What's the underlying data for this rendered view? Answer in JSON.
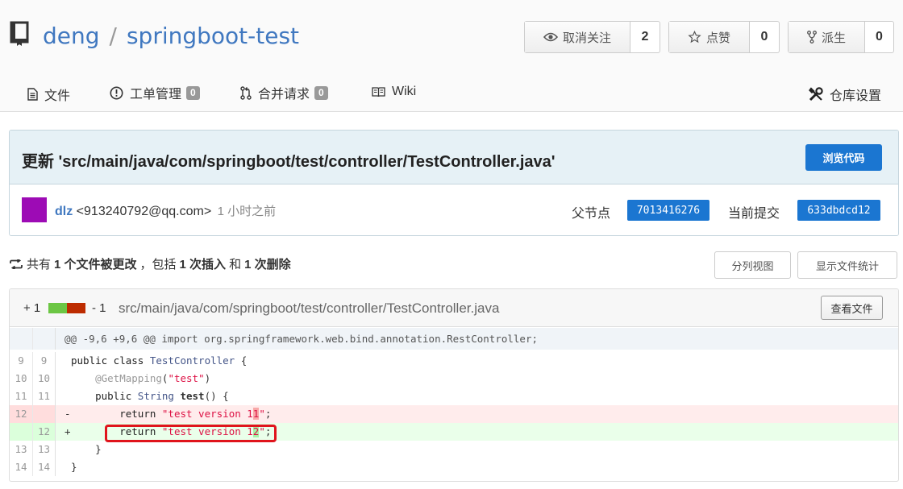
{
  "repo": {
    "owner": "deng",
    "separator": "/",
    "name": "springboot-test"
  },
  "actions": {
    "watch": {
      "label": "取消关注",
      "count": "2",
      "icon": "eye-icon"
    },
    "star": {
      "label": "点赞",
      "count": "0",
      "icon": "star-icon"
    },
    "fork": {
      "label": "派生",
      "count": "0",
      "icon": "fork-icon"
    }
  },
  "nav": {
    "files": "文件",
    "issues": "工单管理",
    "issues_count": "0",
    "pulls": "合并请求",
    "pulls_count": "0",
    "wiki": "Wiki",
    "settings": "仓库设置"
  },
  "commit": {
    "title": "更新 'src/main/java/com/springboot/test/controller/TestController.java'",
    "browse_label": "浏览代码",
    "author_name": "dlz",
    "author_email": "<913240792@qq.com>",
    "time": "1 小时之前",
    "parent_label": "父节点",
    "parent_sha": "7013416276",
    "current_label": "当前提交",
    "current_sha": "633dbdcd12",
    "avatar_color": "#9d0bb5"
  },
  "summary": {
    "p1": "共有",
    "files": "1 个文件被更改",
    "p2": "，包括",
    "insertions": "1 次插入",
    "p3": "和",
    "deletions": "1 次删除",
    "split_label": "分列视图",
    "stats_label": "显示文件统计"
  },
  "file": {
    "additions": "+ 1",
    "deletions": "- 1",
    "path": "src/main/java/com/springboot/test/controller/TestController.java",
    "view_label": "查看文件"
  },
  "diff": {
    "hunk": "@@ -9,6 +9,6 @@ import org.springframework.web.bind.annotation.RestController;",
    "lines": [
      {
        "old": "9",
        "new": "9",
        "sign": "",
        "code": "public class TestController {"
      },
      {
        "old": "10",
        "new": "10",
        "sign": "",
        "code": "    @GetMapping(\"test\")"
      },
      {
        "old": "11",
        "new": "11",
        "sign": "",
        "code": "    public String test() {"
      },
      {
        "old": "12",
        "new": "",
        "sign": "-",
        "code": "        return \"test version 11\";"
      },
      {
        "old": "",
        "new": "12",
        "sign": "+",
        "code": "        return \"test version 12\";"
      },
      {
        "old": "13",
        "new": "13",
        "sign": "",
        "code": "    }"
      },
      {
        "old": "14",
        "new": "14",
        "sign": "",
        "code": "}"
      }
    ]
  }
}
